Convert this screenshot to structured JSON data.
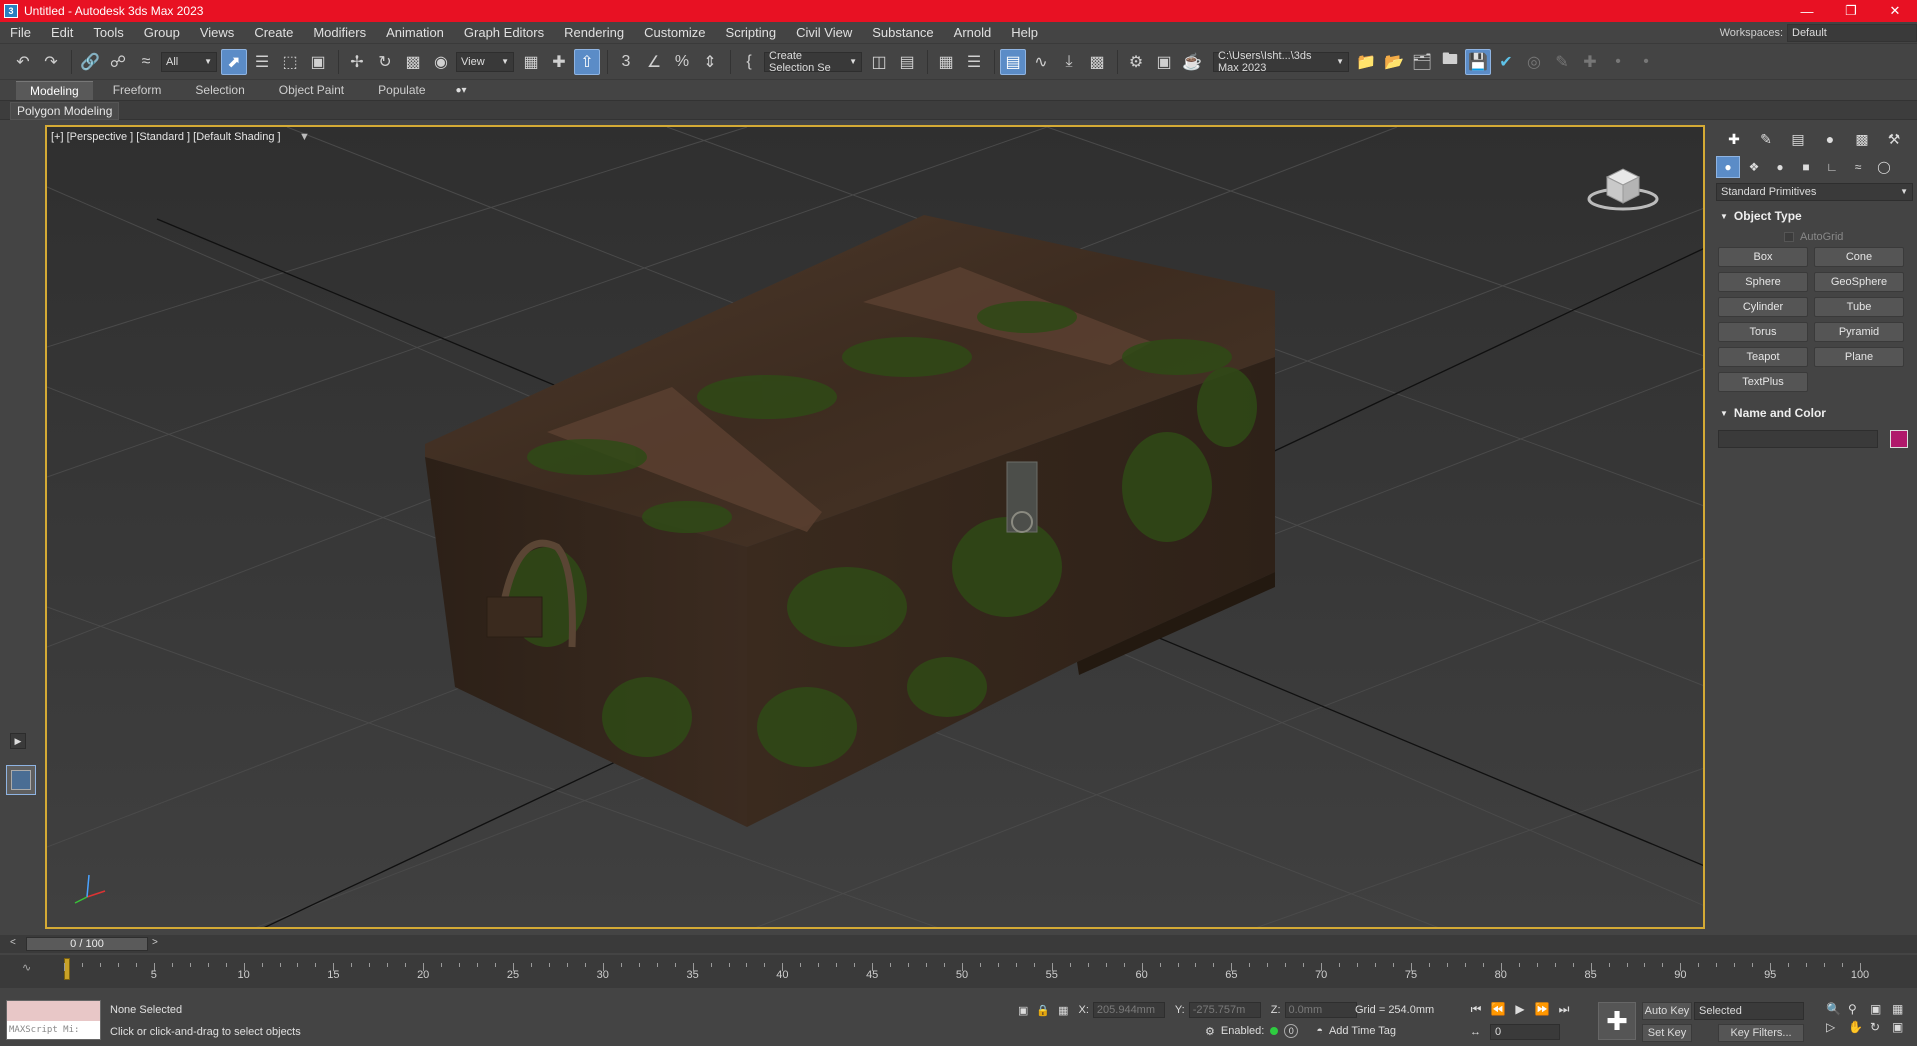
{
  "window": {
    "title": "Untitled - Autodesk 3ds Max 2023",
    "app_icon": "3"
  },
  "menu": {
    "items": [
      "File",
      "Edit",
      "Tools",
      "Group",
      "Views",
      "Create",
      "Modifiers",
      "Animation",
      "Graph Editors",
      "Rendering",
      "Customize",
      "Scripting",
      "Civil View",
      "Substance",
      "Arnold",
      "Help"
    ],
    "workspace_label": "Workspaces:",
    "workspace_value": "Default"
  },
  "toolbar": {
    "filter_value": "All",
    "ref_coord_value": "View",
    "selection_set_value": "Create Selection Se",
    "project_path": "C:\\Users\\Isht...\\3ds Max 2023"
  },
  "ribbon": {
    "tabs": [
      "Modeling",
      "Freeform",
      "Selection",
      "Object Paint",
      "Populate"
    ],
    "active_tab": "Modeling",
    "panel_label": "Polygon Modeling"
  },
  "viewport": {
    "label": "[+] [Perspective ] [Standard ] [Default Shading ]"
  },
  "command_panel": {
    "category_value": "Standard Primitives",
    "object_type_title": "Object Type",
    "autogrid_label": "AutoGrid",
    "primitives": [
      "Box",
      "Cone",
      "Sphere",
      "GeoSphere",
      "Cylinder",
      "Tube",
      "Torus",
      "Pyramid",
      "Teapot",
      "Plane",
      "TextPlus"
    ],
    "name_color_title": "Name and Color",
    "swatch_color": "#b0196b"
  },
  "timeline": {
    "slider_label": "0 / 100",
    "ticks": [
      5,
      10,
      15,
      20,
      25,
      30,
      35,
      40,
      45,
      50,
      55,
      60,
      65,
      70,
      75,
      80,
      85,
      90,
      95,
      100
    ]
  },
  "status": {
    "maxscript_placeholder": "MAXScript Mi:",
    "selection_text": "None Selected",
    "prompt_text": "Click or click-and-drag to select objects",
    "x_label": "X:",
    "x_value": "205.944mm",
    "y_label": "Y:",
    "y_value": "-275.757m",
    "z_label": "Z:",
    "z_value": "0.0mm",
    "grid_text": "Grid = 254.0mm",
    "enabled_label": "Enabled:",
    "enabled_count": "0",
    "add_time_tag": "Add Time Tag",
    "auto_key": "Auto Key",
    "set_key": "Set Key",
    "selected_value": "Selected",
    "key_filters": "Key Filters...",
    "frame_value": "0"
  }
}
